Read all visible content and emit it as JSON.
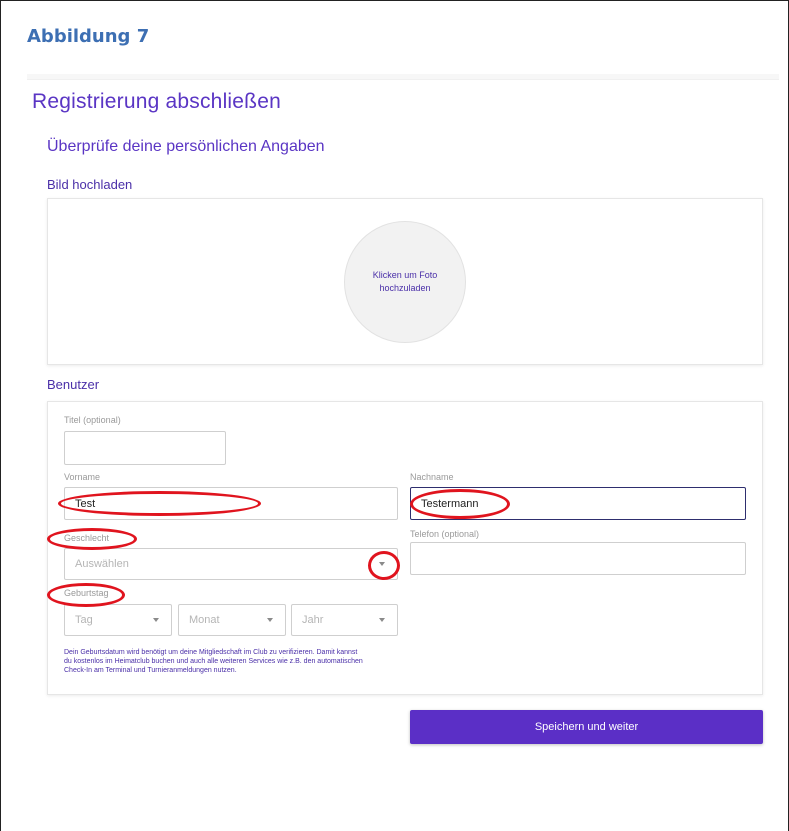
{
  "caption": "Abbildung 7",
  "page_title": "Registrierung abschließen",
  "subtitle": "Überprüfe deine persönlichen Angaben",
  "upload": {
    "section_label": "Bild hochladen",
    "circle_text": "Klicken um Foto hochzuladen"
  },
  "user": {
    "section_label": "Benutzer",
    "titel_label": "Titel (optional)",
    "titel_value": "",
    "vorname_label": "Vorname",
    "vorname_value": "Test",
    "nachname_label": "Nachname",
    "nachname_value": "Testermann",
    "geschlecht_label": "Geschlecht",
    "geschlecht_placeholder": "Auswählen",
    "telefon_label": "Telefon (optional)",
    "telefon_value": "",
    "geburtstag_label": "Geburtstag",
    "tag_placeholder": "Tag",
    "monat_placeholder": "Monat",
    "jahr_placeholder": "Jahr",
    "hint": "Dein Geburtsdatum wird benötigt um deine Mitgliedschaft im Club zu verifizieren. Damit kannst du kostenlos im Heimatclub buchen und auch alle weiteren Services wie z.B. den automatischen Check-In am Terminal und Turnieranmeldungen nutzen."
  },
  "save_button": "Speichern und weiter",
  "colors": {
    "brand": "#5b2fc6",
    "annotation": "#e0141e",
    "caption": "#3d6fb3"
  }
}
